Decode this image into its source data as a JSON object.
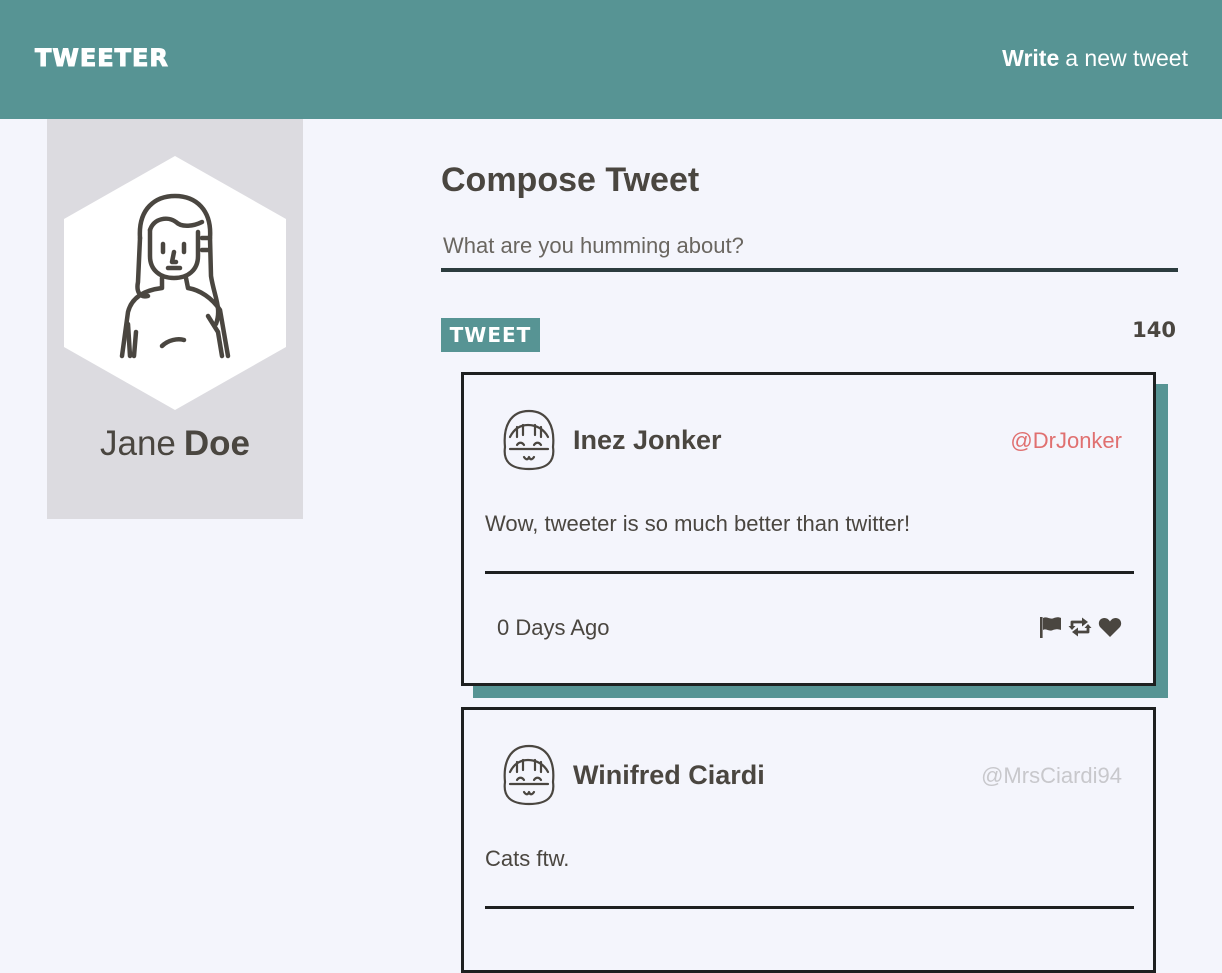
{
  "nav": {
    "brand": "TWEETER",
    "write_bold": "Write",
    "write_rest": "a new tweet",
    "bg_color": "#579494"
  },
  "profile": {
    "first_name": "Jane",
    "last_name": "Doe",
    "avatar_icon": "woman-avatar-icon"
  },
  "compose": {
    "title": "Compose Tweet",
    "placeholder": "What are you humming about?",
    "button_label": "TWEET",
    "counter": "140"
  },
  "tweets": [
    {
      "name": "Inez Jonker",
      "handle": "@DrJonker",
      "handle_color": "#e07070",
      "text": "Wow, tweeter is so much better than twitter!",
      "time": "0 Days Ago",
      "actions": [
        "flag-icon",
        "retweet-icon",
        "heart-icon"
      ]
    },
    {
      "name": "Winifred Ciardi",
      "handle": "@MrsCiardi94",
      "handle_color": "#c8c8cc",
      "text": "Cats ftw."
    }
  ]
}
